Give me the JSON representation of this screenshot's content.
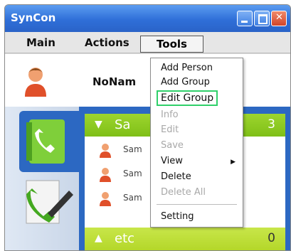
{
  "window": {
    "title": "SynCon"
  },
  "menubar": {
    "main": "Main",
    "actions": "Actions",
    "tools": "Tools"
  },
  "profile": {
    "name": "NoNam"
  },
  "groups": [
    {
      "name": "Sa",
      "count": "3",
      "state": "expanded"
    },
    {
      "name": "etc",
      "count": "0",
      "state": "collapsed"
    }
  ],
  "contacts": [
    {
      "name": "Sam"
    },
    {
      "name": "Sam"
    },
    {
      "name": "Sam"
    }
  ],
  "tools_menu": {
    "items": [
      {
        "label": "Add Person",
        "enabled": true
      },
      {
        "label": "Add Group",
        "enabled": true
      },
      {
        "label": "Edit Group",
        "enabled": true,
        "highlighted": true
      },
      {
        "label": "Info",
        "enabled": false
      },
      {
        "label": "Edit",
        "enabled": false
      },
      {
        "label": "Save",
        "enabled": false
      },
      {
        "label": "View",
        "enabled": true,
        "submenu": true
      },
      {
        "label": "Delete",
        "enabled": true
      },
      {
        "label": "Delete All",
        "enabled": false
      },
      {
        "label": "Setting",
        "enabled": true
      }
    ]
  },
  "colors": {
    "titlebar": "#2f6fd8",
    "accent_blue": "#2c68c2",
    "group_green": "#8fca22",
    "highlight_box": "#2fd06a"
  },
  "icons": {
    "avatar": "person-icon",
    "phonebook": "phonebook-icon",
    "call": "phone-call-icon",
    "contact": "person-icon"
  }
}
